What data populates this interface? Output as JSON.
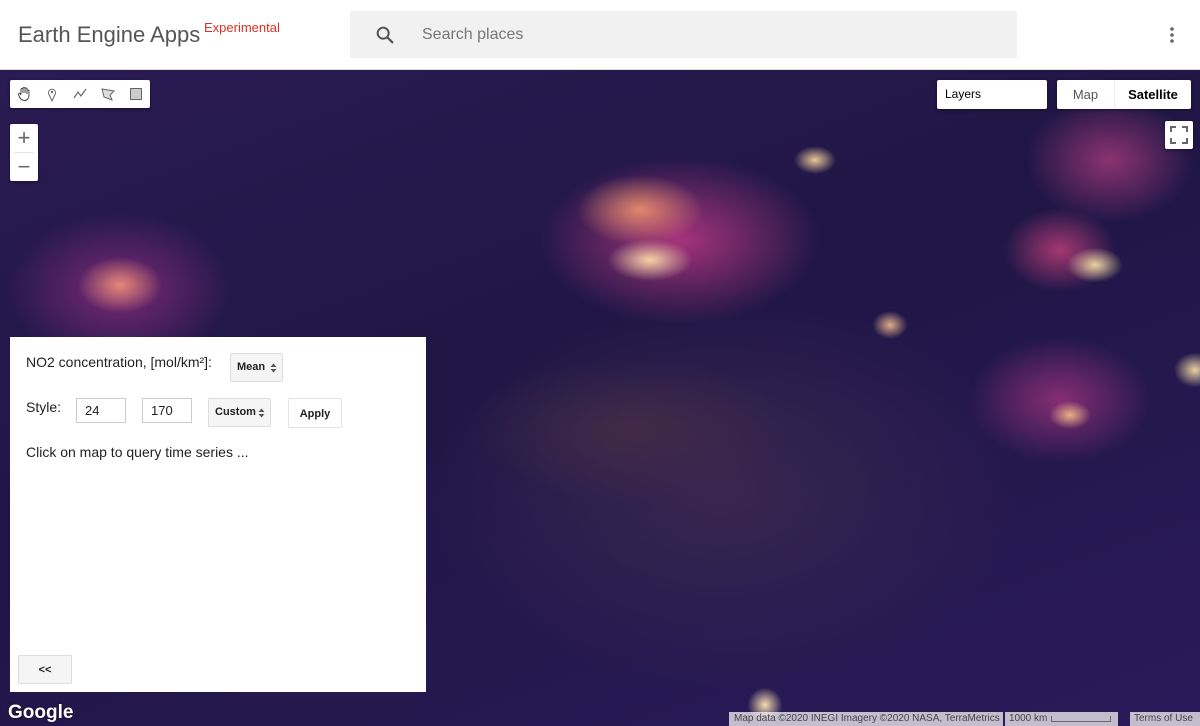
{
  "header": {
    "brand": "Earth Engine Apps",
    "brand_tag": "Experimental",
    "search_placeholder": "Search places",
    "menu_icon": "more-vert-icon"
  },
  "map": {
    "draw_tools": [
      "hand-icon",
      "pin-icon",
      "line-icon",
      "polygon-icon",
      "rectangle-icon"
    ],
    "zoom_in": "+",
    "zoom_out": "−",
    "layers_label": "Layers",
    "maptype": {
      "map": "Map",
      "satellite": "Satellite",
      "selected": "Satellite"
    },
    "fullscreen_icon": "fullscreen-icon"
  },
  "panel": {
    "concentration_label": "NO2 concentration, [mol/km²]:",
    "reducer_select": "Mean",
    "style_label": "Style:",
    "style_min": "24",
    "style_max": "170",
    "palette_select": "Custom",
    "apply_label": "Apply",
    "hint": "Click on map to query time series ...",
    "collapse_label": "<<"
  },
  "footer": {
    "google_logo": "Google",
    "attribution": "Map data ©2020 INEGI Imagery ©2020 NASA, TerraMetrics",
    "scale_label": "1000 km",
    "terms": "Terms of Use"
  }
}
